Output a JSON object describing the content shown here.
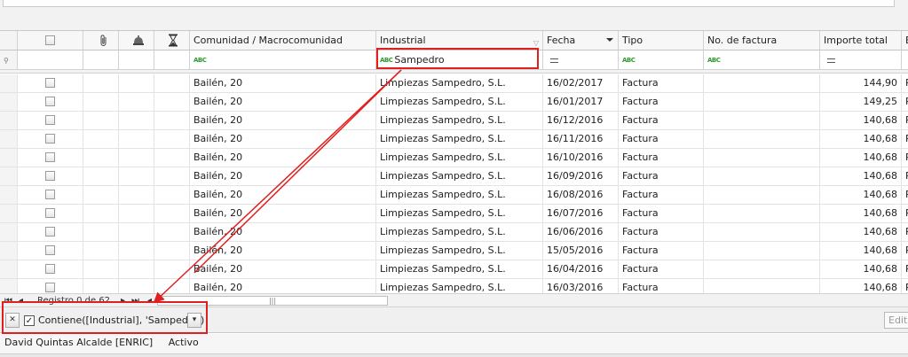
{
  "columns": {
    "comunidad": "Comunidad / Macrocomunidad",
    "industrial": "Industrial",
    "fecha": "Fecha",
    "tipo": "Tipo",
    "factura": "No. de factura",
    "importe": "Importe total",
    "extra": "E"
  },
  "header_icons": [
    "checkbox",
    "paperclip-icon",
    "bell-icon",
    "hourglass-icon"
  ],
  "filter_row": {
    "abc_badge": "ABC",
    "industrial_value": "Sampedro"
  },
  "rows": [
    {
      "comunidad": "Bailén, 20",
      "industrial": "Limpiezas Sampedro, S.L.",
      "fecha": "16/02/2017",
      "tipo": "Factura",
      "importe": "144,90",
      "extra": "P"
    },
    {
      "comunidad": "Bailén, 20",
      "industrial": "Limpiezas Sampedro, S.L.",
      "fecha": "16/01/2017",
      "tipo": "Factura",
      "importe": "149,25",
      "extra": "P"
    },
    {
      "comunidad": "Bailén, 20",
      "industrial": "Limpiezas Sampedro, S.L.",
      "fecha": "16/12/2016",
      "tipo": "Factura",
      "importe": "140,68",
      "extra": "P"
    },
    {
      "comunidad": "Bailén, 20",
      "industrial": "Limpiezas Sampedro, S.L.",
      "fecha": "16/11/2016",
      "tipo": "Factura",
      "importe": "140,68",
      "extra": "P"
    },
    {
      "comunidad": "Bailén, 20",
      "industrial": "Limpiezas Sampedro, S.L.",
      "fecha": "16/10/2016",
      "tipo": "Factura",
      "importe": "140,68",
      "extra": "P"
    },
    {
      "comunidad": "Bailén, 20",
      "industrial": "Limpiezas Sampedro, S.L.",
      "fecha": "16/09/2016",
      "tipo": "Factura",
      "importe": "140,68",
      "extra": "P"
    },
    {
      "comunidad": "Bailén, 20",
      "industrial": "Limpiezas Sampedro, S.L.",
      "fecha": "16/08/2016",
      "tipo": "Factura",
      "importe": "140,68",
      "extra": "P"
    },
    {
      "comunidad": "Bailén, 20",
      "industrial": "Limpiezas Sampedro, S.L.",
      "fecha": "16/07/2016",
      "tipo": "Factura",
      "importe": "140,68",
      "extra": "P"
    },
    {
      "comunidad": "Bailén, 20",
      "industrial": "Limpiezas Sampedro, S.L.",
      "fecha": "16/06/2016",
      "tipo": "Factura",
      "importe": "140,68",
      "extra": "P"
    },
    {
      "comunidad": "Bailén, 20",
      "industrial": "Limpiezas Sampedro, S.L.",
      "fecha": "15/05/2016",
      "tipo": "Factura",
      "importe": "140,68",
      "extra": "P"
    },
    {
      "comunidad": "Bailén, 20",
      "industrial": "Limpiezas Sampedro, S.L.",
      "fecha": "16/04/2016",
      "tipo": "Factura",
      "importe": "140,68",
      "extra": "P"
    },
    {
      "comunidad": "Bailén, 20",
      "industrial": "Limpiezas Sampedro, S.L.",
      "fecha": "16/03/2016",
      "tipo": "Factura",
      "importe": "140,68",
      "extra": "P"
    }
  ],
  "navigator": {
    "record_text": "Registro 0 de 62"
  },
  "filter_panel": {
    "expression": "Contiene([Industrial], 'Sampedro')",
    "edit_label": "Edita"
  },
  "status": {
    "user": "David Quintas Alcalde [ENRIC]",
    "state": "Activo"
  },
  "colors": {
    "annotation": "#e02020",
    "abc_badge": "#2e9a2e",
    "grid_line": "#e3e3e3"
  }
}
